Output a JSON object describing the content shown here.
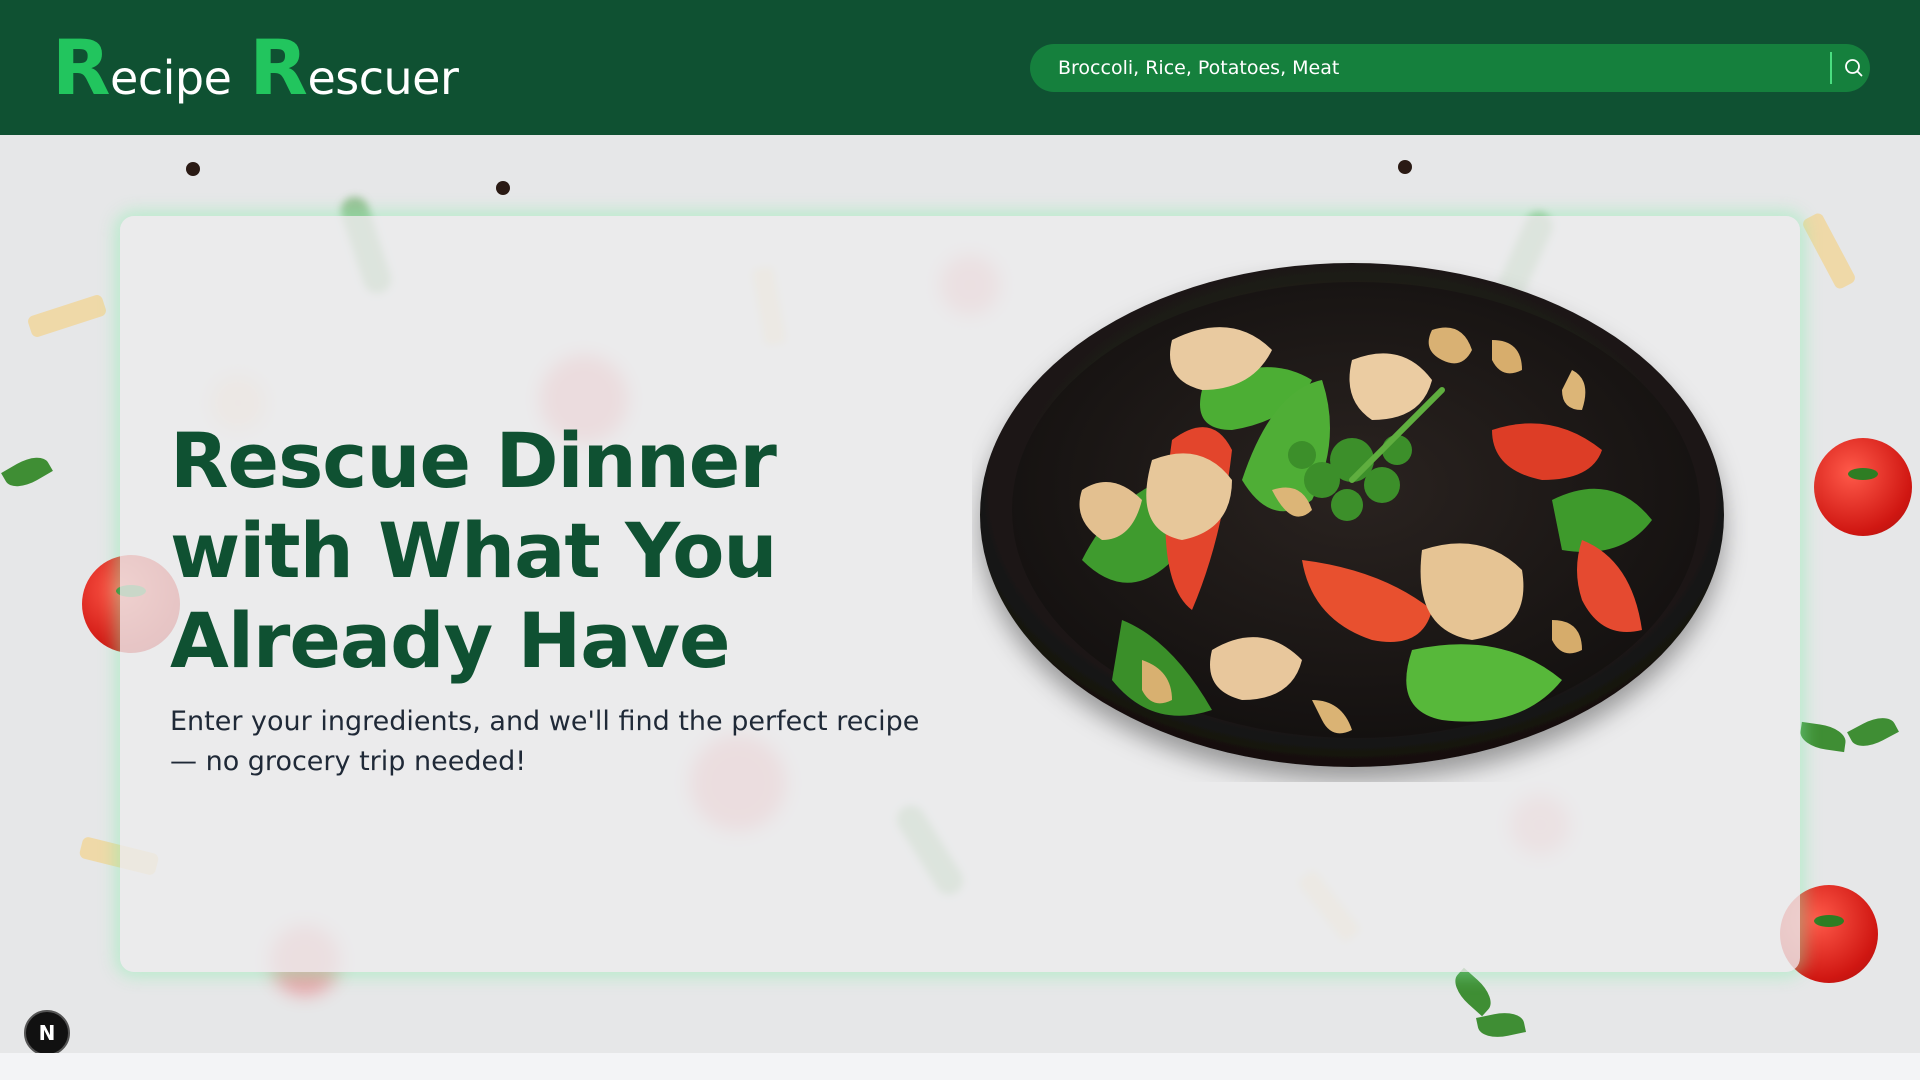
{
  "header": {
    "logo": {
      "word1_initial": "R",
      "word1_rest": "ecipe",
      "word2_initial": "R",
      "word2_rest": "escuer"
    },
    "search": {
      "placeholder": "Broccoli, Rice, Potatoes, Meat",
      "button_icon": "search-icon"
    }
  },
  "hero": {
    "title": "Rescue Dinner with What You Already Have",
    "subtitle": "Enter your ingredients, and we'll find the perfect recipe — no grocery trip needed!",
    "image_icon": "stir-fry-bowl-illustration"
  },
  "dev_badge": {
    "label": "N"
  },
  "colors": {
    "header_bg": "#0f5132",
    "logo_initial": "#22c55e",
    "search_bg": "#15803d",
    "title": "#0f5132",
    "subtitle": "#1f2937",
    "card_glow": "#86efac"
  }
}
